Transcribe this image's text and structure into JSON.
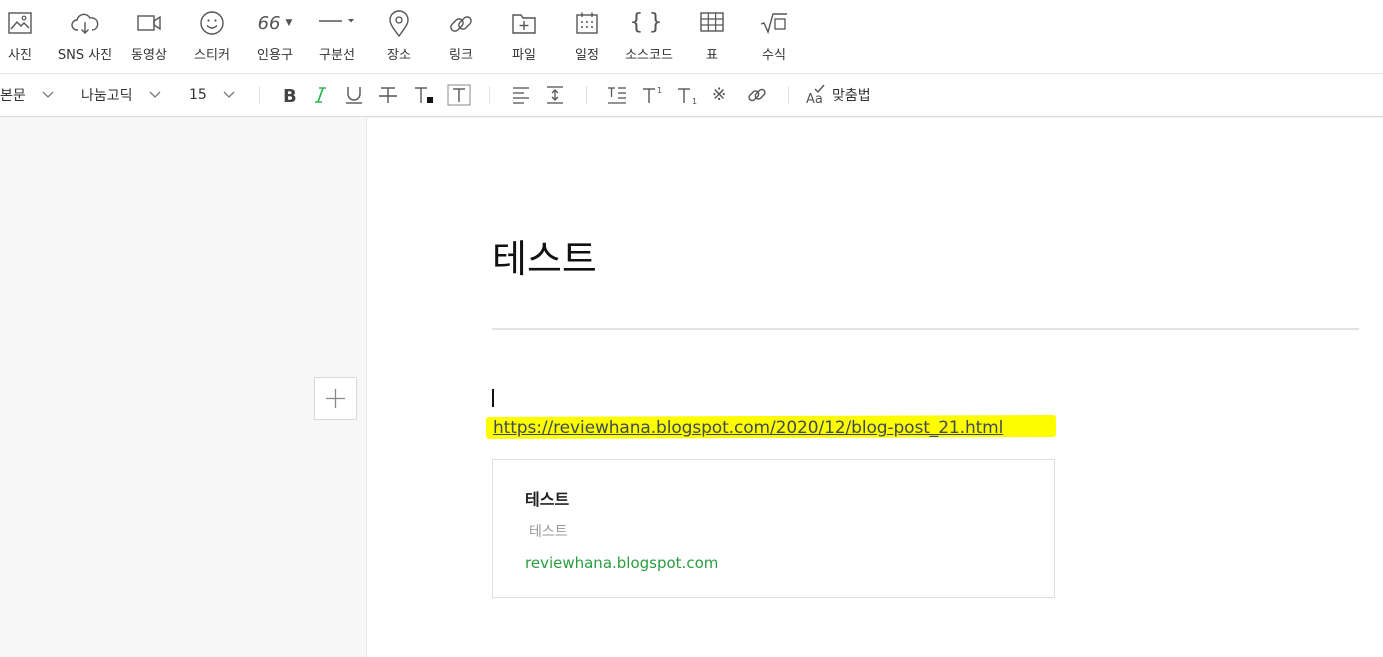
{
  "toolbar": {
    "items": [
      {
        "label": "사진",
        "icon": "image-icon"
      },
      {
        "label": "SNS 사진",
        "icon": "cloud-download-icon"
      },
      {
        "label": "동영상",
        "icon": "video-camera-icon"
      },
      {
        "label": "스티커",
        "icon": "smiley-icon"
      },
      {
        "label": "인용구",
        "icon": "quote-icon"
      },
      {
        "label": "구분선",
        "icon": "horizontal-line-icon"
      },
      {
        "label": "장소",
        "icon": "map-pin-icon"
      },
      {
        "label": "링크",
        "icon": "link-icon"
      },
      {
        "label": "파일",
        "icon": "file-add-icon"
      },
      {
        "label": "일정",
        "icon": "calendar-icon"
      },
      {
        "label": "소스코드",
        "icon": "braces-icon"
      },
      {
        "label": "표",
        "icon": "table-icon"
      },
      {
        "label": "수식",
        "icon": "square-root-icon"
      }
    ],
    "quote_glyph": "66"
  },
  "format": {
    "paragraph_style": "본문",
    "font": "나눔고딕",
    "size": "15",
    "spellcheck": "맞춤법",
    "accent_green": "#1fb34a"
  },
  "document": {
    "title": "테스트",
    "link_url": "https://reviewhana.blogspot.com/2020/12/blog-post_21.html",
    "highlight_color": "#fdfd00",
    "card": {
      "title": "테스트",
      "description": "테스트",
      "domain": "reviewhana.blogspot.com"
    }
  }
}
